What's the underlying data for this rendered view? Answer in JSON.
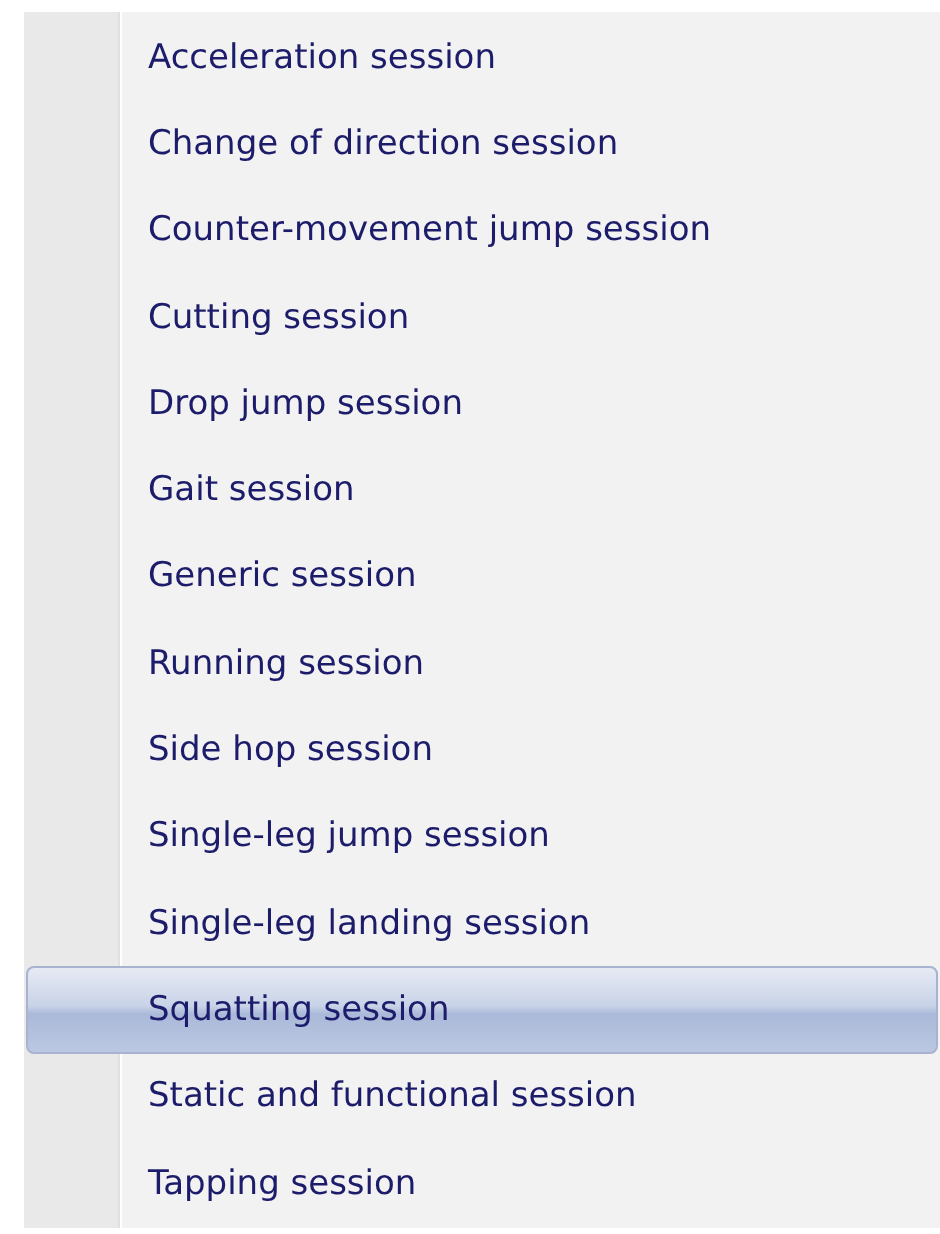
{
  "menu": {
    "items": [
      {
        "label": "Acceleration session",
        "selected": false
      },
      {
        "label": "Change of direction session",
        "selected": false
      },
      {
        "label": "Counter-movement jump session",
        "selected": false
      },
      {
        "label": "Cutting session",
        "selected": false
      },
      {
        "label": "Drop jump session",
        "selected": false
      },
      {
        "label": "Gait session",
        "selected": false
      },
      {
        "label": "Generic session",
        "selected": false
      },
      {
        "label": "Running session",
        "selected": false
      },
      {
        "label": "Side hop session",
        "selected": false
      },
      {
        "label": "Single-leg jump session",
        "selected": false
      },
      {
        "label": "Single-leg landing session",
        "selected": false
      },
      {
        "label": "Squatting session",
        "selected": true
      },
      {
        "label": "Static and functional session",
        "selected": false
      },
      {
        "label": "Tapping session",
        "selected": false
      }
    ]
  }
}
